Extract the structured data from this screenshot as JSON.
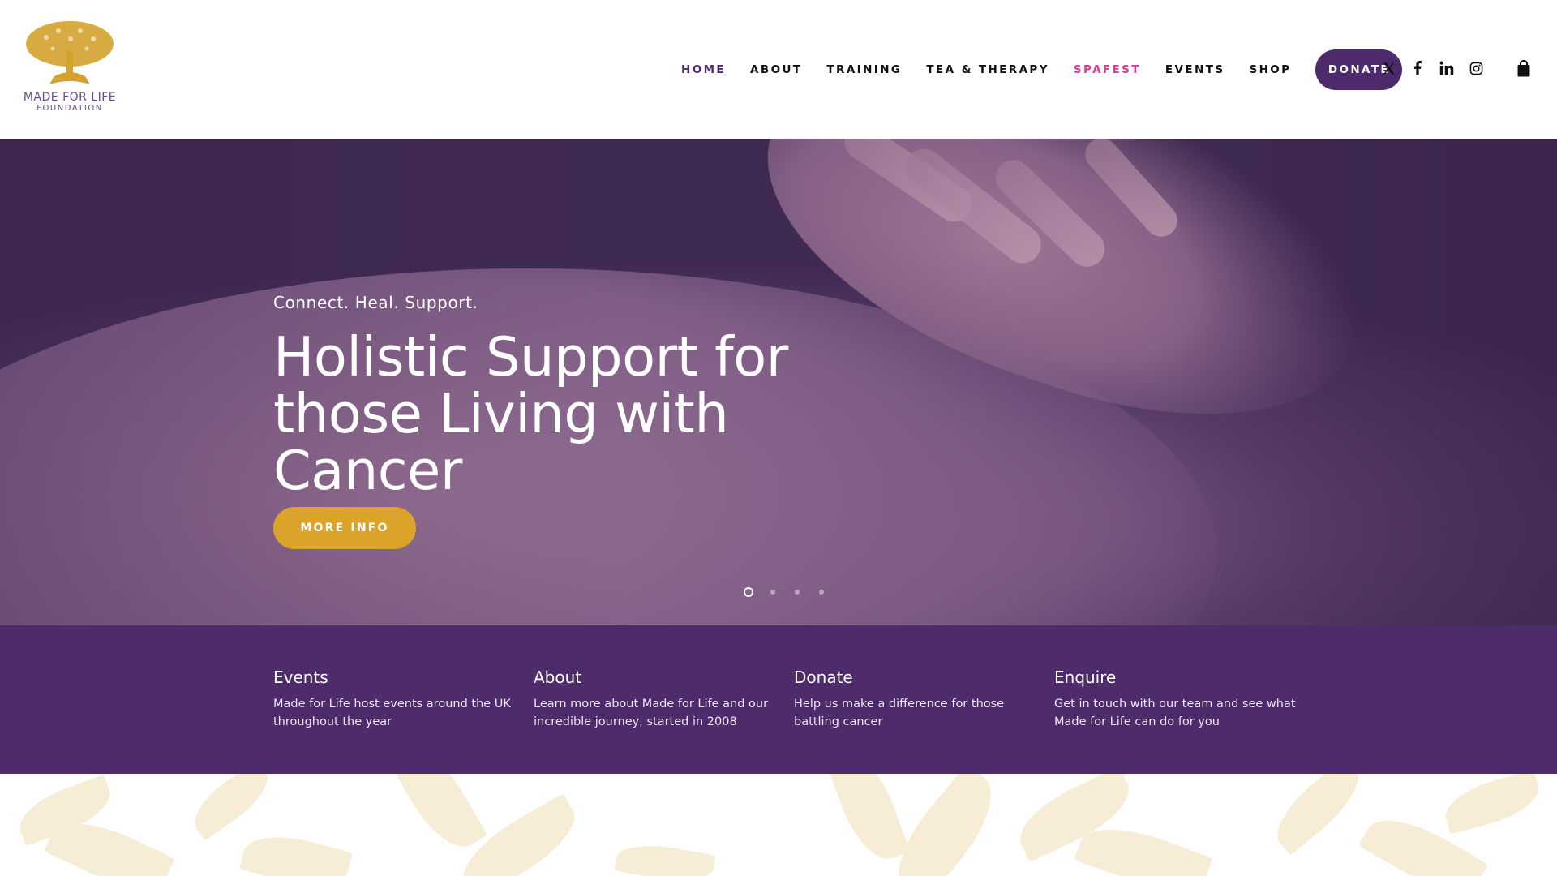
{
  "brand": {
    "name_line1": "MADE FOR LIFE",
    "name_line2": "FOUNDATION",
    "logo_color": "#d4a22e",
    "text_color": "#6a4a8c"
  },
  "nav": {
    "items": [
      {
        "label": "HOME",
        "state": "active"
      },
      {
        "label": "ABOUT",
        "state": "normal"
      },
      {
        "label": "TRAINING",
        "state": "normal"
      },
      {
        "label": "TEA & THERAPY",
        "state": "normal"
      },
      {
        "label": "SPAFEST",
        "state": "highlight"
      },
      {
        "label": "EVENTS",
        "state": "normal"
      },
      {
        "label": "SHOP",
        "state": "normal"
      }
    ],
    "donate_label": "DONATE",
    "social_icons": [
      "x-icon",
      "facebook-icon",
      "linkedin-icon",
      "instagram-icon"
    ],
    "cart_icon": "shopping-bag-icon"
  },
  "hero": {
    "eyebrow": "Connect. Heal. Support.",
    "title": "Holistic Support for those Living with Cancer",
    "button_label": "MORE INFO",
    "slides_total": 4,
    "active_slide": 1
  },
  "features": [
    {
      "title": "Events",
      "text": "Made for Life host events around the UK throughout the year"
    },
    {
      "title": "About",
      "text": "Learn more about Made for Life and our incredible journey, started in 2008"
    },
    {
      "title": "Donate",
      "text": "Help us make a difference for those battling cancer"
    },
    {
      "title": "Enquire",
      "text": "Get in touch with our team and see what Made for Life can do for you"
    }
  ],
  "colors": {
    "brand_purple": "#4e2b6b",
    "accent_gold": "#dca32a",
    "highlight_pink": "#d63c92"
  }
}
